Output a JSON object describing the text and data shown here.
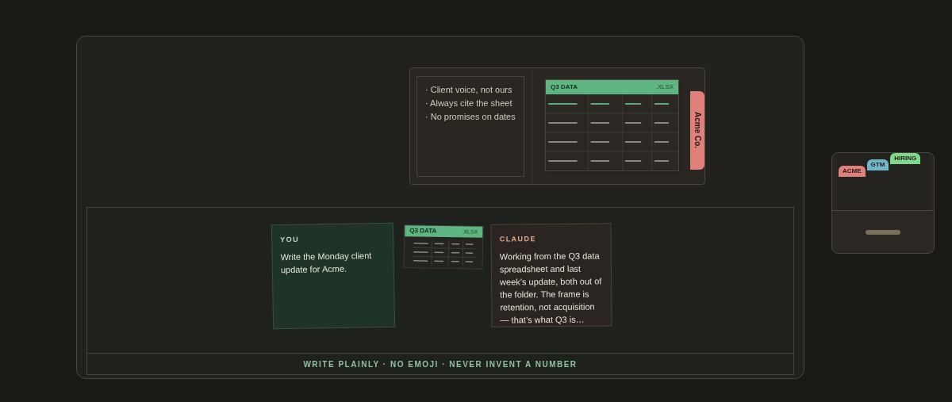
{
  "folder": {
    "notes": [
      "· Client voice, not ours",
      "· Always cite the sheet",
      "· No promises on dates"
    ],
    "sheet": {
      "title": "Q3 DATA",
      "ext": ".XLSX"
    },
    "tab": "Acme Co."
  },
  "chat": {
    "user": {
      "speaker": "YOU",
      "text": "Write the Monday client update for Acme."
    },
    "attachment": {
      "title": "Q3 DATA",
      "ext": ".XLSX"
    },
    "reply": {
      "speaker": "CLAUDE",
      "text": "Working from the Q3 data spreadsheet and last week’s update, both out of the folder. The frame is retention, not acquisition — that’s what Q3 is…"
    }
  },
  "footer": "WRITE PLAINLY · NO EMOJI · NEVER INVENT A NUMBER",
  "cabinet": {
    "tabs": [
      {
        "label": "ACME",
        "color": "#e0807a"
      },
      {
        "label": "GTM",
        "color": "#6fb8cc"
      },
      {
        "label": "HIRING",
        "color": "#7ed98a"
      }
    ]
  }
}
